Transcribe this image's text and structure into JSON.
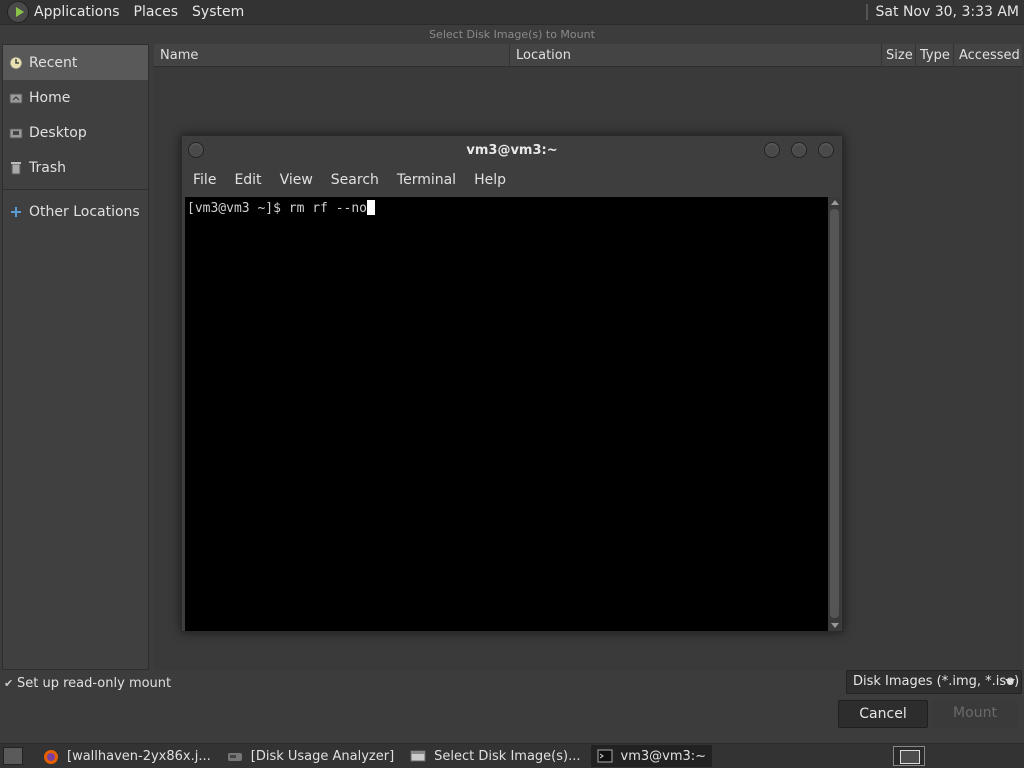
{
  "top_panel": {
    "menus": [
      "Applications",
      "Places",
      "System"
    ],
    "clock": "Sat Nov 30,  3:33 AM"
  },
  "dialog": {
    "title": "Select Disk Image(s) to Mount",
    "sidebar": [
      {
        "label": "Recent",
        "icon": "recent-icon"
      },
      {
        "label": "Home",
        "icon": "home-folder-icon"
      },
      {
        "label": "Desktop",
        "icon": "desktop-folder-icon"
      },
      {
        "label": "Trash",
        "icon": "trash-icon"
      },
      {
        "label": "Other Locations",
        "icon": "plus-icon"
      }
    ],
    "columns": [
      "Name",
      "Location",
      "Size",
      "Type",
      "Accessed"
    ],
    "readonly_label": "Set up read-only mount",
    "filter": "Disk Images (*.img, *.iso)",
    "cancel_label": "Cancel",
    "mount_label": "Mount"
  },
  "terminal": {
    "title": "vm3@vm3:~",
    "menus": [
      "File",
      "Edit",
      "View",
      "Search",
      "Terminal",
      "Help"
    ],
    "prompt": "[vm3@vm3 ~]$ rm rf --no"
  },
  "taskbar": {
    "tasks": [
      {
        "label": "[wallhaven-2yx86x.j...",
        "icon": "firefox-icon"
      },
      {
        "label": "[Disk Usage Analyzer]",
        "icon": "disk-usage-icon"
      },
      {
        "label": "Select Disk Image(s)...",
        "icon": "window-icon"
      },
      {
        "label": "vm3@vm3:~",
        "icon": "terminal-icon"
      }
    ]
  },
  "colors": {
    "panel_bg": "#333333",
    "dialog_bg": "#3c3c3c",
    "terminal_bg": "#000000",
    "text": "#dcdcdc",
    "disabled": "#6a6a6a"
  }
}
